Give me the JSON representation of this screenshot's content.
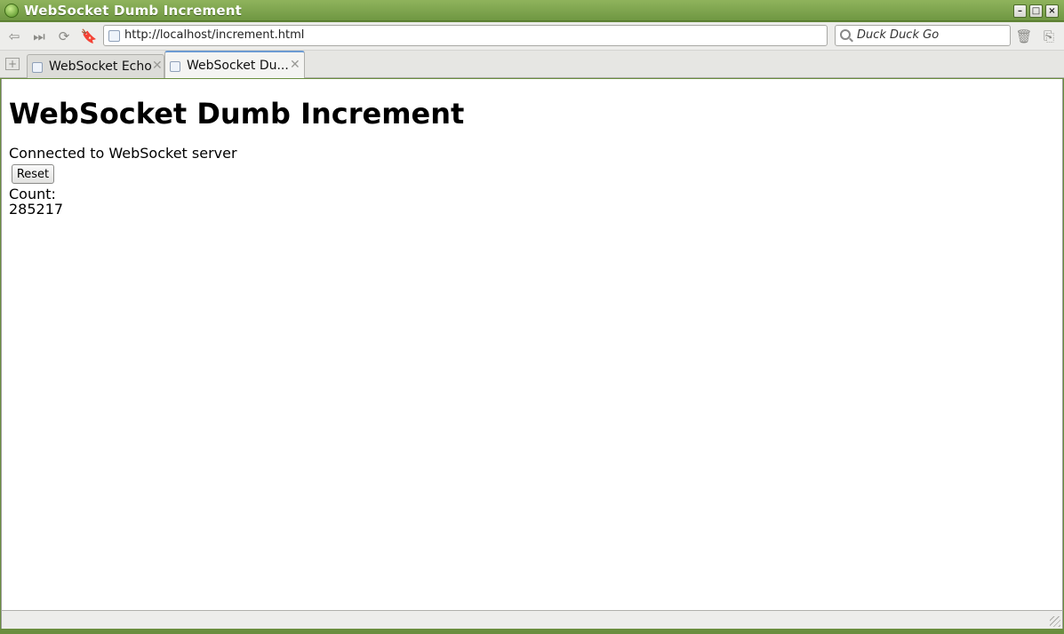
{
  "window": {
    "title": "WebSocket Dumb Increment",
    "controls": {
      "minimize": "–",
      "maximize": "□",
      "close": "×"
    }
  },
  "navbar": {
    "url": "http://localhost/increment.html",
    "search_placeholder": "Duck Duck Go"
  },
  "tabs": [
    {
      "label": "WebSocket Echo",
      "active": false
    },
    {
      "label": "WebSocket Du...",
      "active": true
    }
  ],
  "page": {
    "heading": "WebSocket Dumb Increment",
    "status": "Connected to WebSocket server",
    "reset_label": "Reset",
    "count_label": "Count:",
    "count_value": "285217"
  },
  "icons": {
    "back": "back-arrow-icon",
    "forward": "forward-icon",
    "reload": "reload-icon",
    "bookmark": "bookmark-icon",
    "trash": "trash-icon",
    "page_info": "page-info-icon"
  },
  "colors": {
    "titlebar": "#7ba24c",
    "active_tab_accent": "#6c9bd2"
  }
}
